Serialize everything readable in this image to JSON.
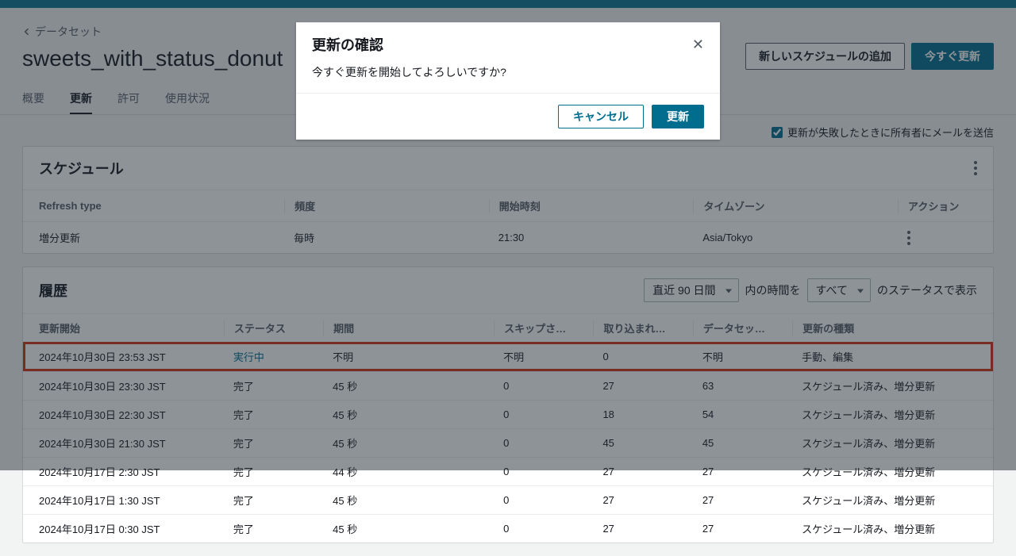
{
  "breadcrumb": {
    "label": "データセット"
  },
  "page": {
    "title": "sweets_with_status_donut"
  },
  "actions": {
    "add_schedule": "新しいスケジュールの追加",
    "refresh_now": "今すぐ更新"
  },
  "tabs": {
    "overview": "概要",
    "refresh": "更新",
    "permission": "許可",
    "usage": "使用状況"
  },
  "checkbox": {
    "label": "更新が失敗したときに所有者にメールを送信"
  },
  "schedule": {
    "title": "スケジュール",
    "headers": {
      "refresh_type": "Refresh type",
      "frequency": "頻度",
      "start_time": "開始時刻",
      "timezone": "タイムゾーン",
      "action": "アクション"
    },
    "row": {
      "refresh_type": "増分更新",
      "frequency": "毎時",
      "start_time": "21:30",
      "timezone": "Asia/Tokyo"
    }
  },
  "history": {
    "title": "履歴",
    "filter": {
      "range": "直近 90 日間",
      "mid": "内の時間を",
      "status": "すべて",
      "suffix": "のステータスで表示"
    },
    "headers": {
      "start": "更新開始",
      "status": "ステータス",
      "duration": "期間",
      "skipped": "スキップさ…",
      "imported": "取り込まれ…",
      "dataset": "データセッ…",
      "type": "更新の種類"
    },
    "rows": [
      {
        "start": "2024年10月30日 23:53 JST",
        "status": "実行中",
        "duration": "不明",
        "skipped": "不明",
        "imported": "0",
        "dataset": "不明",
        "type": "手動、編集",
        "running": true,
        "highlight": true
      },
      {
        "start": "2024年10月30日 23:30 JST",
        "status": "完了",
        "duration": "45 秒",
        "skipped": "0",
        "imported": "27",
        "dataset": "63",
        "type": "スケジュール済み、増分更新"
      },
      {
        "start": "2024年10月30日 22:30 JST",
        "status": "完了",
        "duration": "45 秒",
        "skipped": "0",
        "imported": "18",
        "dataset": "54",
        "type": "スケジュール済み、増分更新"
      },
      {
        "start": "2024年10月30日 21:30 JST",
        "status": "完了",
        "duration": "45 秒",
        "skipped": "0",
        "imported": "45",
        "dataset": "45",
        "type": "スケジュール済み、増分更新"
      },
      {
        "start": "2024年10月17日 2:30 JST",
        "status": "完了",
        "duration": "44 秒",
        "skipped": "0",
        "imported": "27",
        "dataset": "27",
        "type": "スケジュール済み、増分更新"
      },
      {
        "start": "2024年10月17日 1:30 JST",
        "status": "完了",
        "duration": "45 秒",
        "skipped": "0",
        "imported": "27",
        "dataset": "27",
        "type": "スケジュール済み、増分更新"
      },
      {
        "start": "2024年10月17日 0:30 JST",
        "status": "完了",
        "duration": "45 秒",
        "skipped": "0",
        "imported": "27",
        "dataset": "27",
        "type": "スケジュール済み、増分更新"
      }
    ]
  },
  "modal": {
    "title": "更新の確認",
    "body": "今すぐ更新を開始してよろしいですか?",
    "cancel": "キャンセル",
    "confirm": "更新"
  }
}
